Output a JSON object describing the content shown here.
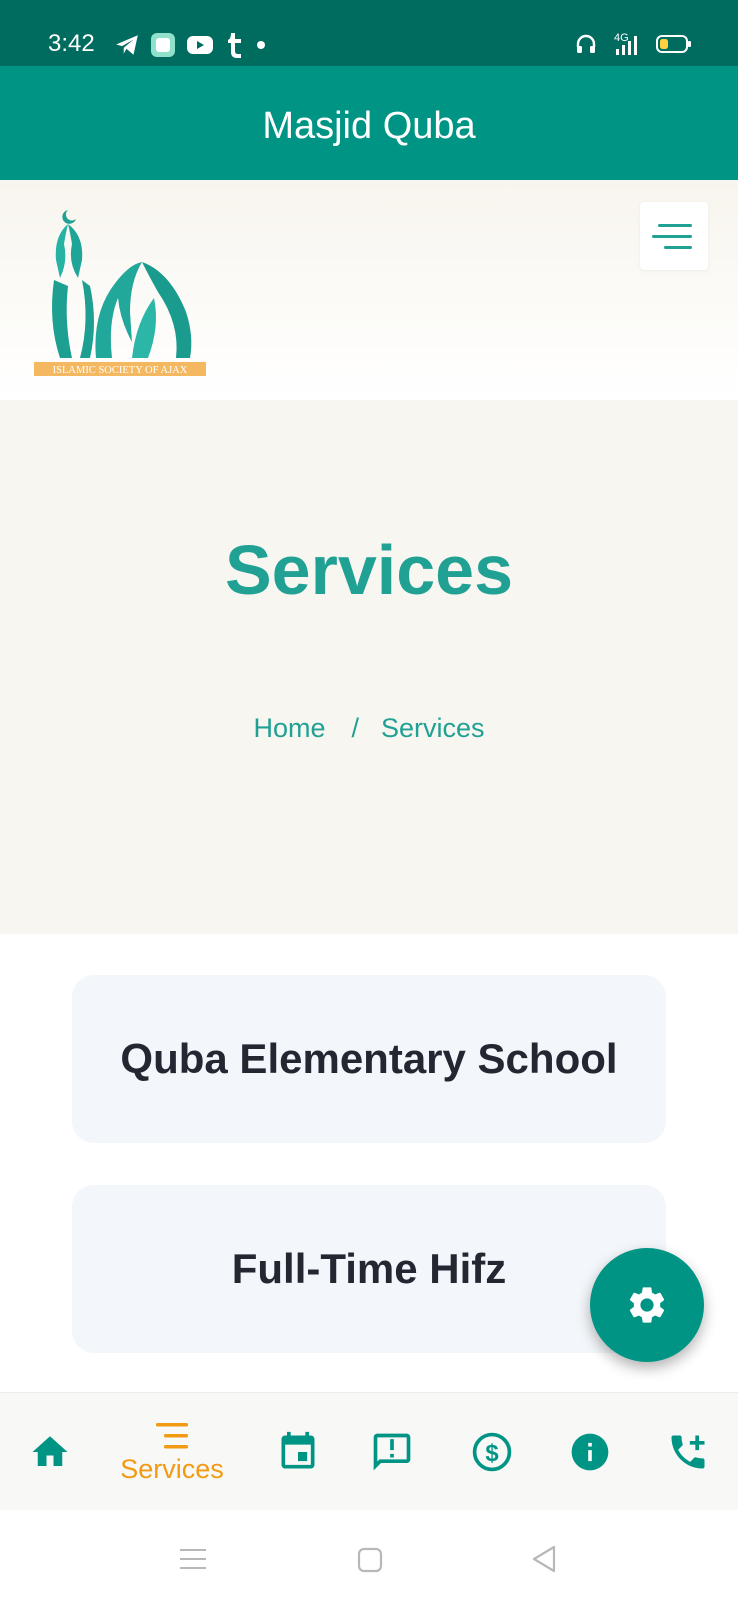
{
  "status_bar": {
    "time": "3:42",
    "network": "4G",
    "left_icons": [
      "telegram-icon",
      "app-notification-icon",
      "youtube-icon",
      "tumblr-icon",
      "dot-icon"
    ],
    "right_icons": [
      "headphones-icon",
      "signal-icon",
      "battery-icon"
    ]
  },
  "app_bar": {
    "title": "Masjid Quba"
  },
  "site_header": {
    "logo_text": "ISLAMIC SOCIETY OF AJAX",
    "menu_icon": "menu-icon"
  },
  "hero": {
    "title": "Services",
    "breadcrumb": {
      "home": "Home",
      "separator": "/",
      "current": "Services"
    }
  },
  "services": [
    {
      "title": "Quba Elementary School"
    },
    {
      "title": "Full-Time Hifz"
    }
  ],
  "fab": {
    "icon": "settings-icon"
  },
  "bottom_nav": {
    "items": [
      {
        "icon": "home-icon",
        "label": ""
      },
      {
        "icon": "services-icon",
        "label": "Services",
        "active": true
      },
      {
        "icon": "calendar-icon",
        "label": ""
      },
      {
        "icon": "feedback-icon",
        "label": ""
      },
      {
        "icon": "donate-icon",
        "label": ""
      },
      {
        "icon": "info-icon",
        "label": ""
      },
      {
        "icon": "add-call-icon",
        "label": ""
      }
    ]
  },
  "system_nav": [
    "recents-icon",
    "home-square-icon",
    "back-icon"
  ],
  "colors": {
    "status_bar": "#006b5f",
    "primary": "#009485",
    "accent_teal": "#20a194",
    "active_orange": "#f29a14",
    "hero_bg": "#f8f6f0",
    "card_bg": "#f3f6fa",
    "card_text": "#232732",
    "logo_gold": "#f4b860"
  }
}
